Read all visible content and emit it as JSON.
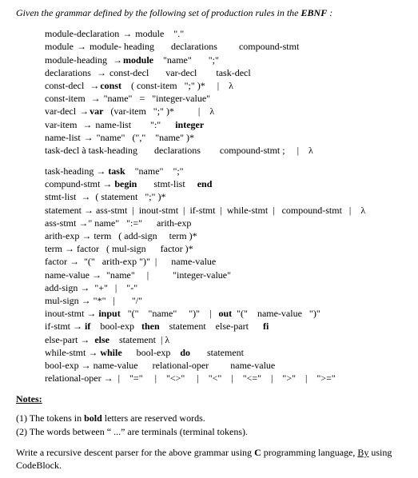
{
  "title": "Given the grammar defined by the following set of production rules  in the ",
  "ebnf": "EBNF",
  "title_tail": " :",
  "lambda": "λ",
  "arrow": "→",
  "rulesA": [
    {
      "parts": [
        "module-declaration ",
        " module    \".\""
      ]
    },
    {
      "parts": [
        "module ",
        " module- heading       declarations         compound-stmt"
      ]
    },
    {
      "parts": [
        "module-heading  ",
        ""
      ],
      "bold": "module",
      "tail": "    \"name\"       \";\""
    },
    {
      "parts": [
        "declarations  ",
        " const-decl       var-decl        task-decl"
      ]
    },
    {
      "parts": [
        "const-decl  ",
        ""
      ],
      "bold": "const",
      "tail": "    ( const-item   \";\" )*     |    λ"
    },
    {
      "parts": [
        "const-item  ",
        " \"name\"   =   \"integer-value\""
      ]
    },
    {
      "parts": [
        "var-decl ",
        ""
      ],
      "bold": "var",
      "tail": "   (var-item   \";\" )*          |    λ"
    },
    {
      "parts": [
        "var-item  ",
        " name-list        \":\"      "
      ],
      "bold2": "integer"
    },
    {
      "parts": [
        "name-list ",
        " \"name\"   (\",\"    \"name\" )*"
      ]
    },
    {
      "parts": [
        "task-decl à task-heading       declarations        compound-stmt ;     |    λ"
      ],
      "noarrow": true
    }
  ],
  "rulesB": [
    {
      "r": "task-heading → ",
      "b": "task",
      "t": "    \"name\"    \";\""
    },
    {
      "r": "compund-stmt → ",
      "b": "begin",
      "t": "       stmt-list     ",
      "b2": "end"
    },
    {
      "r": "stmt-list  →  ( statement   \";\" )*"
    },
    {
      "r": "statement → ass-stmt  |  inout-stmt  |  if-stmt  |  while-stmt  |   compound-stmt   |    λ"
    },
    {
      "r": "ass-stmt →\" name\"   \":=\"      arith-exp"
    },
    {
      "r": "arith-exp → term   ( add-sign     term )*"
    },
    {
      "r": "term → factor   ( mul-sign      factor )*"
    },
    {
      "r": "factor →  \"(\"   arith-exp \")\"  |      name-value"
    },
    {
      "r": "name-value →  \"name\"     |          \"integer-value\""
    },
    {
      "r": "add-sign →  \"+\"   |    \"-\""
    },
    {
      "r": "mul-sign → \"*\"   |       \"/\""
    },
    {
      "r": "inout-stmt → ",
      "b": "input",
      "t": "   \"(\"    \"name\"     \")\"    |   ",
      "b2": "out",
      "t2": "  \"(\"    name-value   \")\""
    },
    {
      "r": "if-stmt → ",
      "b": "if",
      "t": "    bool-exp   ",
      "b2": "then",
      "t2": "    statement    else-part      ",
      "b3": "fi"
    },
    {
      "r": "else-part →  ",
      "b": "else",
      "t": "    statement  | λ"
    },
    {
      "r": "while-stmt → ",
      "b": "while",
      "t": "      bool-exp    ",
      "b2": "do",
      "t2": "       statement"
    },
    {
      "r": "bool-exp → name-value      relational-oper         name-value"
    },
    {
      "r": "relational-oper →  |    \"=\"     |    \"<>\"     |    \"<\"    |    \"<=\"    |    \">\"    |    \">=\""
    }
  ],
  "notes_head": "Notes:",
  "notes": [
    {
      "a": "(1) The tokens in ",
      "b": "bold",
      "c": " letters are reserved words."
    },
    {
      "a": "(2) The words between  “ ...”   are terminals (terminal tokens)."
    }
  ],
  "final_a": "Write  a recursive descent parser for the above grammar using ",
  "final_C": "C",
  "final_b": " programming language, ",
  "final_by": "By",
  "final_c": " using CodeBlock."
}
